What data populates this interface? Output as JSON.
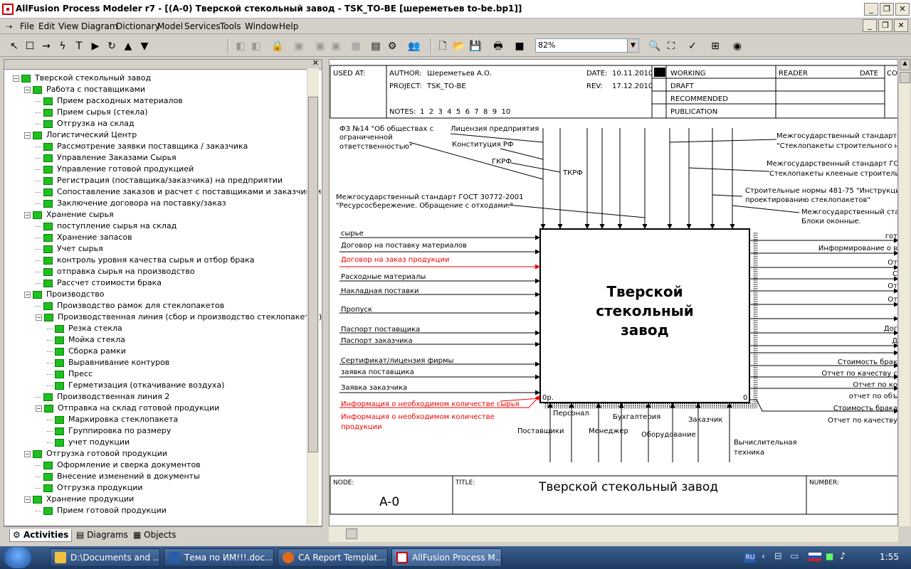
{
  "window": {
    "title": "AllFusion Process Modeler r7 - [(A-0) Тверской стекольный завод - TSK_TO-BE  [шереметьев to-be.bp1]]",
    "menu": [
      "File",
      "Edit",
      "View",
      "Diagram",
      "Dictionary",
      "Model",
      "Services",
      "Tools",
      "Window",
      "Help"
    ],
    "zoom": "82%"
  },
  "tree": [
    {
      "label": "Тверской стекольный завод",
      "level": 0,
      "expanded": true
    },
    {
      "label": "Работа с поставщиками",
      "level": 1,
      "expanded": true
    },
    {
      "label": "Прием расходных  материалов",
      "level": 2
    },
    {
      "label": "Прием сырья (стекла)",
      "level": 2
    },
    {
      "label": "Отгрузка  на склад",
      "level": 2
    },
    {
      "label": "Логистический Центр",
      "level": 1,
      "expanded": true
    },
    {
      "label": "Рассмотрение заявки поставщика / заказчика",
      "level": 2
    },
    {
      "label": "Управление Заказами Сырья",
      "level": 2
    },
    {
      "label": "Управление  готовой продукцией",
      "level": 2
    },
    {
      "label": "Регистрация (поставщика/заказчика) на предприятии",
      "level": 2
    },
    {
      "label": "Сопоставление заказов и расчет с поставщиками и заказчиками",
      "level": 2
    },
    {
      "label": "Заключение договора на поставку/заказ",
      "level": 2
    },
    {
      "label": "Хранение  сырья",
      "level": 1,
      "expanded": true
    },
    {
      "label": "поступление сырья на склад",
      "level": 2
    },
    {
      "label": "Хранение  запасов",
      "level": 2
    },
    {
      "label": "Учет сырья",
      "level": 2
    },
    {
      "label": "контроль уровня качества сырья и отбор брака",
      "level": 2
    },
    {
      "label": "отправка сырья  на производство",
      "level": 2
    },
    {
      "label": "Рассчет  стоимости брака",
      "level": 2
    },
    {
      "label": "Производство",
      "level": 1,
      "expanded": true
    },
    {
      "label": "Производство рамок для стеклопакетов",
      "level": 2
    },
    {
      "label": "Производственная  линия (сбор и производство стеклопакетов)",
      "level": 2,
      "expanded": true
    },
    {
      "label": "Резка  стекла",
      "level": 3
    },
    {
      "label": "Мойка стекла",
      "level": 3
    },
    {
      "label": "Сборка рамки",
      "level": 3
    },
    {
      "label": "Выравнивание контуров",
      "level": 3
    },
    {
      "label": "Пресс",
      "level": 3
    },
    {
      "label": "Герметизация (откачивание  воздуха)",
      "level": 3
    },
    {
      "label": "Производственная  линия 2",
      "level": 2
    },
    {
      "label": "Отправка на склад готовой продукции",
      "level": 2,
      "expanded": true
    },
    {
      "label": "Маркировка стеклопакета",
      "level": 3
    },
    {
      "label": "Группировка по размеру",
      "level": 3
    },
    {
      "label": "учет подукции",
      "level": 3
    },
    {
      "label": "Отгрузка готовой продукции",
      "level": 1,
      "expanded": true
    },
    {
      "label": "Оформление и сверка документов",
      "level": 2
    },
    {
      "label": "Внесение изменений в документы",
      "level": 2
    },
    {
      "label": "Отгрузка  продукции",
      "level": 2
    },
    {
      "label": "Хранение продукции",
      "level": 1,
      "expanded": true
    },
    {
      "label": "Прием готовой продукции",
      "level": 2
    }
  ],
  "left_tabs": [
    "Activities",
    "Diagrams",
    "Objects"
  ],
  "header": {
    "used_at": "USED AT:",
    "author_label": "AUTHOR:",
    "author": "Шереметьев А.О.",
    "project_label": "PROJECT:",
    "project": "TSK_TO-BE",
    "date_label": "DATE:",
    "date": "10.11.2010",
    "rev_label": "REV:",
    "rev": "17.12.2010",
    "notes_label": "NOTES:",
    "notes": "1  2  3  4  5  6  7  8  9  10",
    "status": [
      "WORKING",
      "DRAFT",
      "RECOMMENDED",
      "PUBLICATION"
    ],
    "reader": "READER",
    "date2": "DATE",
    "context": "CO"
  },
  "box": {
    "title_lines": [
      "Тверской",
      "стекольный",
      "завод"
    ],
    "cost": "0р.",
    "number": "0"
  },
  "controls": [
    "ФЗ №14 \"Об обществах с",
    "ограниченной",
    "ответственностью\"",
    "Лицензия предприятия",
    "Конституция РФ",
    "ГКРФ",
    "ТКРФ",
    "Межгосударственный стандарт ГОСТ 30772-2001",
    "\"Ресурсосбережение. Обращение с отходами.\"",
    "Межгосударственный стандарт З",
    "\"Стеклопакеты строительного на",
    "Межгосударственный стандарт ГОС",
    "Стеклопакеты клееные строитель",
    "Строительные нормы 481-75 \"Инструкция",
    "проектированию стеклопакетов\"",
    "Межгосударственный ста",
    "Блоки оконные."
  ],
  "inputs": [
    {
      "label": "сырье",
      "red": false
    },
    {
      "label": "Договор на поставку материалов",
      "red": false
    },
    {
      "label": "Договор на заказ продукции",
      "red": true
    },
    {
      "label": "Расходные материалы",
      "red": false
    },
    {
      "label": "Накладная поставки",
      "red": false
    },
    {
      "label": "Пропуск",
      "red": false
    },
    {
      "label": "Паспорт поставщика",
      "red": false
    },
    {
      "label": "Паспорт заказчика",
      "red": false
    },
    {
      "label": "Сертификат/лицензия фирмы",
      "red": false
    },
    {
      "label": "заявка поставщика",
      "red": false
    },
    {
      "label": "Заявка заказчика",
      "red": false
    },
    {
      "label": "Информация о необходимом количестве сырья",
      "red": true
    },
    {
      "label": "Информация о необходимом количестве",
      "red": true
    },
    {
      "label": "продукции",
      "red": true
    }
  ],
  "outputs": [
    "гот",
    "Информирование о в",
    "От",
    "С",
    "От",
    "От",
    "Дог",
    "Д",
    "Стоимость брак",
    "Отчет по качеству с",
    "Отчет по ко",
    "отчет по объ",
    "Стоимость брака",
    "Отчет по качеству"
  ],
  "mechanisms": [
    "Персонал",
    "Поставщики",
    "Менеджер",
    "Бухгалтерия",
    "Оборудование",
    "Заказчик",
    "Вычислительная",
    "техника"
  ],
  "footer": {
    "node_label": "NODE:",
    "node": "A-0",
    "title_label": "TITLE:",
    "title": "Тверской стекольный завод",
    "number_label": "NUMBER:"
  },
  "taskbar": {
    "items": [
      "D:\\Documents and ...",
      "Тема по ИМ!!!.doc...",
      "CA Report Templat...",
      "AllFusion Process M..."
    ],
    "lang": "RU",
    "clock": "1:55"
  }
}
